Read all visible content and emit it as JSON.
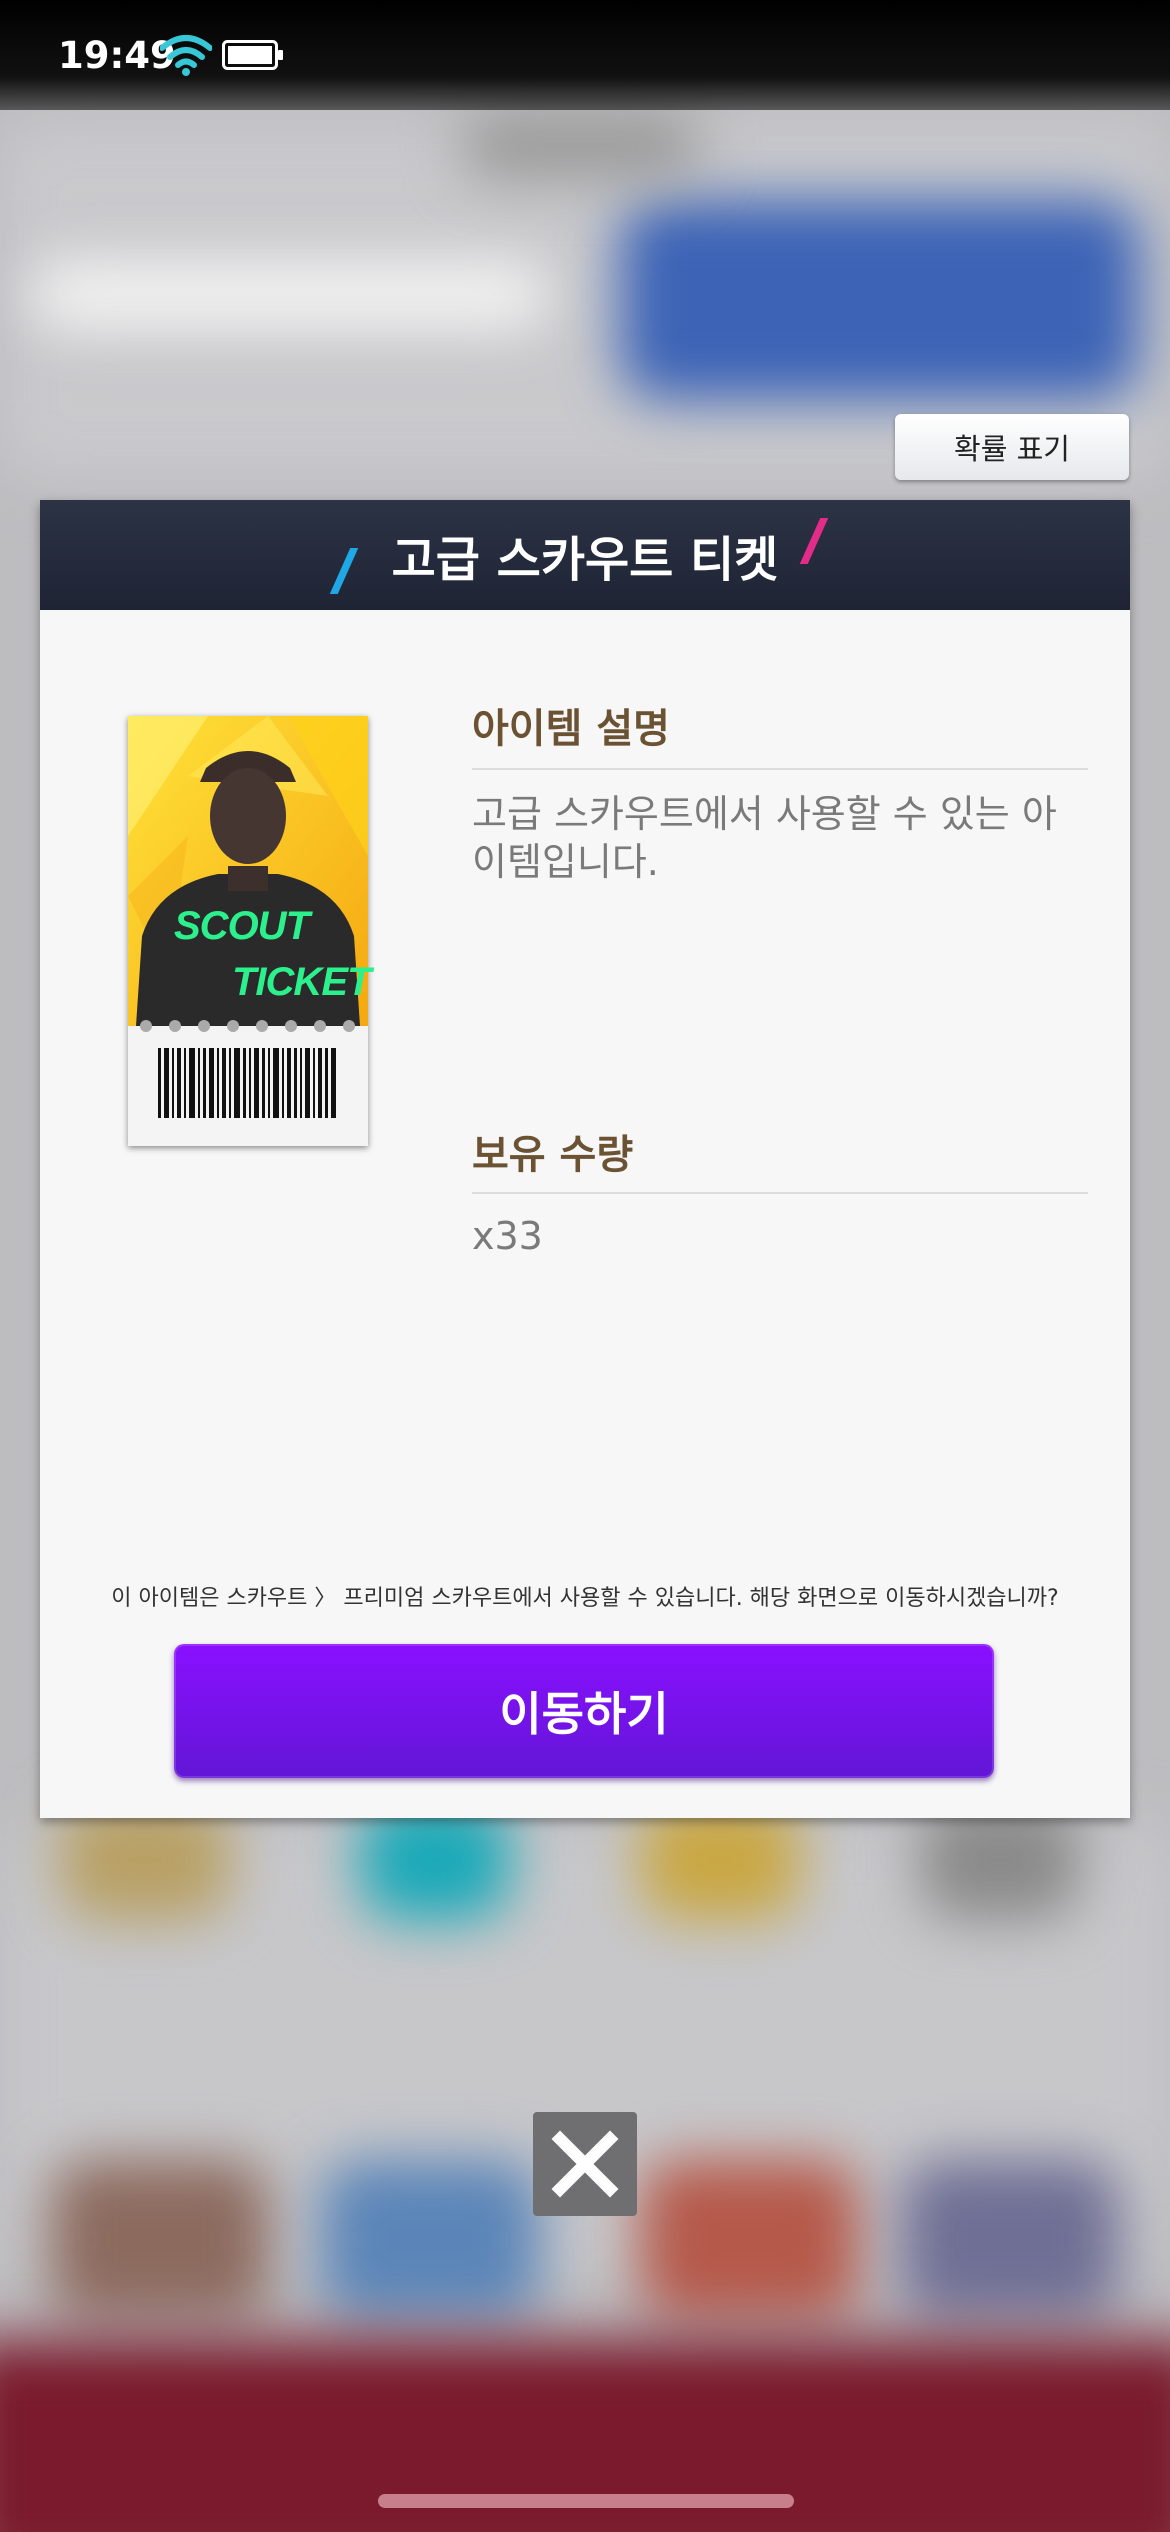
{
  "status_bar": {
    "time": "19:49",
    "wifi_icon": "wifi-icon",
    "battery_icon": "battery-icon"
  },
  "probability_button": {
    "label": "확률 표기"
  },
  "dialog": {
    "title": "고급 스카우트 티켓",
    "item_image": {
      "line1": "SCOUT",
      "line2": "TICKET"
    },
    "description": {
      "heading": "아이템 설명",
      "text": "고급 스카우트에서 사용할 수 있는 아이템입니다."
    },
    "quantity": {
      "heading": "보유 수량",
      "value": "x33"
    },
    "notice": "이 아이템은 스카우트 〉 프리미엄 스카우트에서 사용할 수 있습니다. 해당 화면으로 이동하시겠습니까?",
    "move_button": "이동하기"
  },
  "close_button": {
    "icon": "close-icon"
  },
  "colors": {
    "header": "#262c3d",
    "accent_blue": "#20a7e6",
    "accent_pink": "#e22c88",
    "button_purple": "#7a12f0",
    "section_heading": "#6b5233"
  }
}
